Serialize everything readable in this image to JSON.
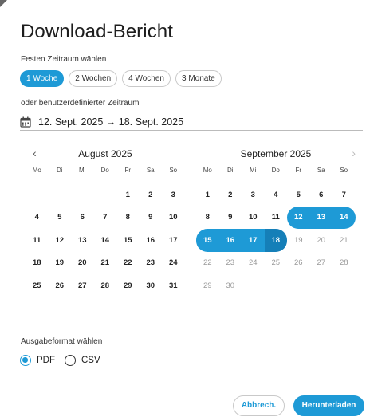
{
  "dialog": {
    "title": "Download-Bericht"
  },
  "fixed_range": {
    "label": "Festen Zeitraum wählen",
    "options": [
      "1 Woche",
      "2 Wochen",
      "4 Wochen",
      "3 Monate"
    ],
    "selected": "1 Woche"
  },
  "custom_range": {
    "label": "oder benutzerdefinierter Zeitraum",
    "value": "12. Sept. 2025 → 18. Sept. 2025",
    "icon": "calendar-icon"
  },
  "calendars": {
    "weekdays": [
      "Mo",
      "Di",
      "Mi",
      "Do",
      "Fr",
      "Sa",
      "So"
    ],
    "left": {
      "title": "August 2025",
      "prev_icon": "‹",
      "weeks": [
        [
          "",
          "",
          "",
          "",
          "1",
          "2",
          "3"
        ],
        [
          "4",
          "5",
          "6",
          "7",
          "8",
          "9",
          "10"
        ],
        [
          "11",
          "12",
          "13",
          "14",
          "15",
          "16",
          "17"
        ],
        [
          "18",
          "19",
          "20",
          "21",
          "22",
          "23",
          "24"
        ],
        [
          "25",
          "26",
          "27",
          "28",
          "29",
          "30",
          "31"
        ]
      ]
    },
    "right": {
      "title": "September 2025",
      "next_icon": "›",
      "weeks": [
        [
          "1",
          "2",
          "3",
          "4",
          "5",
          "6",
          "7"
        ],
        [
          "8",
          "9",
          "10",
          "11",
          "12",
          "13",
          "14"
        ],
        [
          "15",
          "16",
          "17",
          "18",
          "19",
          "20",
          "21"
        ],
        [
          "22",
          "23",
          "24",
          "25",
          "26",
          "27",
          "28"
        ],
        [
          "29",
          "30",
          "",
          "",
          "",
          "",
          ""
        ]
      ],
      "selected_start": "12",
      "selected_end": "18",
      "muted_after": "18"
    }
  },
  "format": {
    "label": "Ausgabeformat wählen",
    "options": [
      "PDF",
      "CSV"
    ],
    "selected": "PDF"
  },
  "actions": {
    "cancel_label": "Abbrech.",
    "download_label": "Herunterladen"
  },
  "colors": {
    "accent": "#1e9ad6",
    "accent_dark": "#157fb8"
  }
}
